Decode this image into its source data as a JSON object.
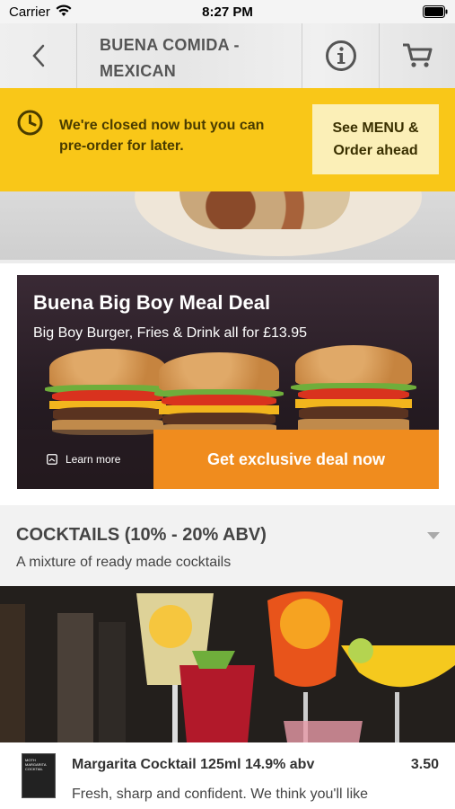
{
  "status_bar": {
    "carrier": "Carrier",
    "time": "8:27 PM",
    "wifi_icon": "wifi-icon",
    "battery_icon": "battery-icon"
  },
  "header": {
    "title_line1": "BUENA COMIDA -",
    "title_line2": "MEXICAN",
    "back_icon": "chevron-left-icon",
    "info_icon": "info-icon",
    "cart_icon": "cart-icon"
  },
  "closed_banner": {
    "icon": "clock-icon",
    "message_line1": "We're closed now but you can",
    "message_line2": "pre-order for later.",
    "button_line1": "See MENU &",
    "button_line2": "Order ahead",
    "background_color": "#f9c718"
  },
  "deal": {
    "title": "Buena Big Boy Meal Deal",
    "subtitle": "Big Boy Burger, Fries & Drink all for £13.95",
    "learn_more_label": "Learn more",
    "button_label": "Get exclusive deal now",
    "button_color": "#f08c1e"
  },
  "section": {
    "title": "COCKTAILS (10% - 20% ABV)",
    "description": "A mixture of ready made cocktails",
    "toggle_icon": "caret-down-icon"
  },
  "menu_item": {
    "name": "Margarita Cocktail 125ml 14.9% abv",
    "price": "3.50",
    "description": "Fresh, sharp and confident. We think you'll like",
    "thumb_text": "MOTH MARGARITA COCKTAIL"
  }
}
